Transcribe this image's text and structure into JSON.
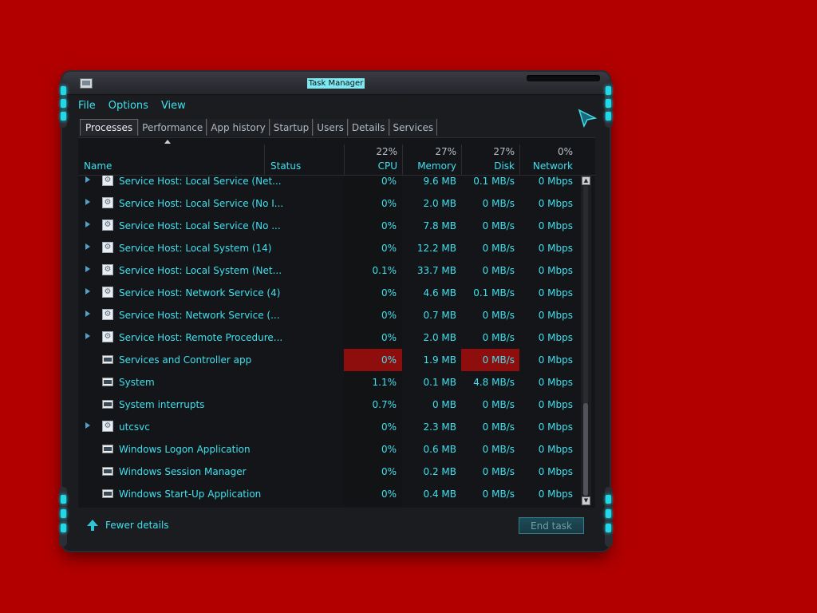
{
  "window": {
    "title": "Task Manager",
    "menu": [
      "File",
      "Options",
      "View"
    ],
    "tabs": [
      "Processes",
      "Performance",
      "App history",
      "Startup",
      "Users",
      "Details",
      "Services"
    ]
  },
  "header": {
    "name": "Name",
    "status": "Status",
    "cpu_pct": "22%",
    "cpu": "CPU",
    "mem_pct": "27%",
    "mem": "Memory",
    "disk_pct": "27%",
    "disk": "Disk",
    "net_pct": "0%",
    "net": "Network"
  },
  "rows": [
    {
      "name": "Service Host: Local Service (Net...",
      "cpu": "0%",
      "mem": "9.6 MB",
      "disk": "0.1 MB/s",
      "net": "0 Mbps"
    },
    {
      "name": "Service Host: Local Service (No I...",
      "cpu": "0%",
      "mem": "2.0 MB",
      "disk": "0 MB/s",
      "net": "0 Mbps"
    },
    {
      "name": "Service Host: Local Service (No ...",
      "cpu": "0%",
      "mem": "7.8 MB",
      "disk": "0 MB/s",
      "net": "0 Mbps"
    },
    {
      "name": "Service Host: Local System (14)",
      "cpu": "0%",
      "mem": "12.2 MB",
      "disk": "0 MB/s",
      "net": "0 Mbps"
    },
    {
      "name": "Service Host: Local System (Net...",
      "cpu": "0.1%",
      "mem": "33.7 MB",
      "disk": "0 MB/s",
      "net": "0 Mbps"
    },
    {
      "name": "Service Host: Network Service (4)",
      "cpu": "0%",
      "mem": "4.6 MB",
      "disk": "0.1 MB/s",
      "net": "0 Mbps"
    },
    {
      "name": "Service Host: Network Service (...",
      "cpu": "0%",
      "mem": "0.7 MB",
      "disk": "0 MB/s",
      "net": "0 Mbps"
    },
    {
      "name": "Service Host: Remote Procedure...",
      "cpu": "0%",
      "mem": "2.0 MB",
      "disk": "0 MB/s",
      "net": "0 Mbps"
    },
    {
      "name": "Services and Controller app",
      "cpu": "0%",
      "mem": "1.9 MB",
      "disk": "0 MB/s",
      "net": "0 Mbps"
    },
    {
      "name": "System",
      "cpu": "1.1%",
      "mem": "0.1 MB",
      "disk": "4.8 MB/s",
      "net": "0 Mbps"
    },
    {
      "name": "System interrupts",
      "cpu": "0.7%",
      "mem": "0 MB",
      "disk": "0 MB/s",
      "net": "0 Mbps"
    },
    {
      "name": "utcsvc",
      "cpu": "0%",
      "mem": "2.3 MB",
      "disk": "0 MB/s",
      "net": "0 Mbps"
    },
    {
      "name": "Windows Logon Application",
      "cpu": "0%",
      "mem": "0.6 MB",
      "disk": "0 MB/s",
      "net": "0 Mbps"
    },
    {
      "name": "Windows Session Manager",
      "cpu": "0%",
      "mem": "0.2 MB",
      "disk": "0 MB/s",
      "net": "0 Mbps"
    },
    {
      "name": "Windows Start-Up Application",
      "cpu": "0%",
      "mem": "0.4 MB",
      "disk": "0 MB/s",
      "net": "0 Mbps"
    }
  ],
  "footer": {
    "fewer_details": "Fewer details",
    "end_task": "End task"
  }
}
